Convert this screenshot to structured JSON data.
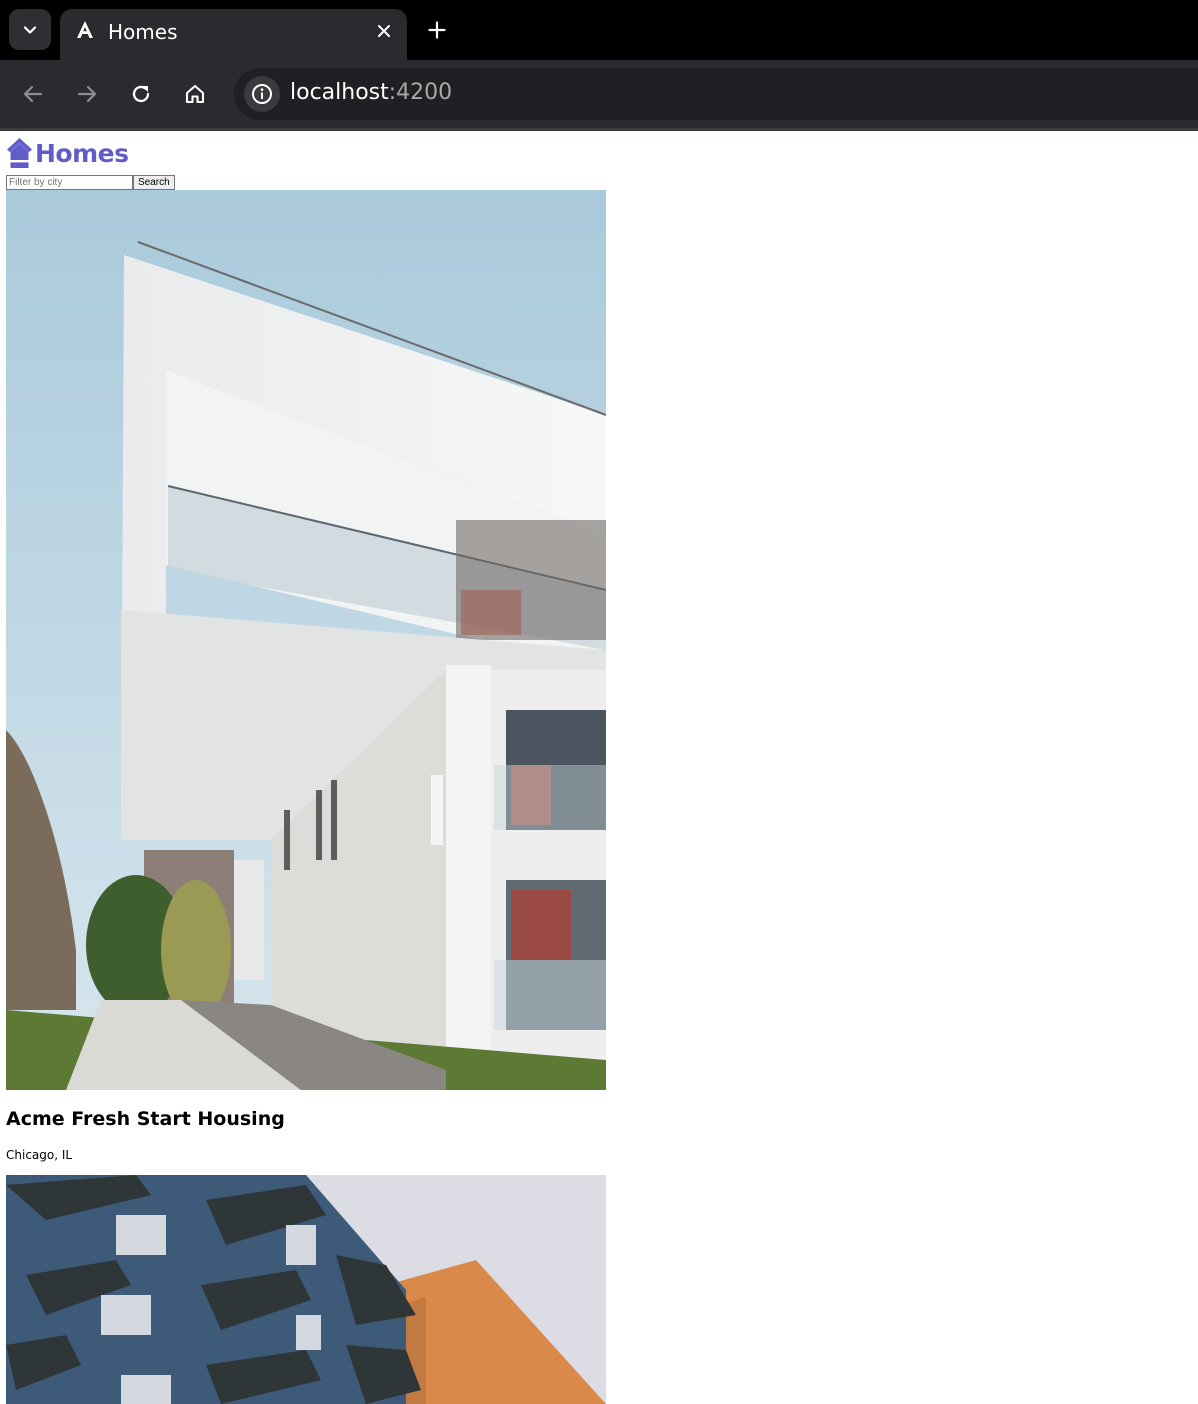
{
  "browser": {
    "tab": {
      "title": "Homes",
      "favicon": "angular-icon"
    },
    "address": {
      "host": "localhost",
      "port": ":4200"
    },
    "icons": {
      "tab_search": "chevron-down-icon",
      "tab_close": "close-icon",
      "new_tab": "plus-icon",
      "back": "back-arrow-icon",
      "forward": "forward-arrow-icon",
      "reload": "reload-icon",
      "home": "home-icon",
      "site_info": "info-icon"
    }
  },
  "app": {
    "brand": {
      "name": "Homes",
      "icon": "house-icon",
      "color": "#605dc8"
    },
    "search": {
      "placeholder": "Filter by city",
      "value": "",
      "button_label": "Search"
    },
    "listings": [
      {
        "name": "Acme Fresh Start Housing",
        "location": "Chicago, IL",
        "photo": "white modern apartment building with balconies against blue sky"
      },
      {
        "name": "",
        "location": "",
        "photo": "blue and orange apartment building with balconies"
      }
    ]
  }
}
